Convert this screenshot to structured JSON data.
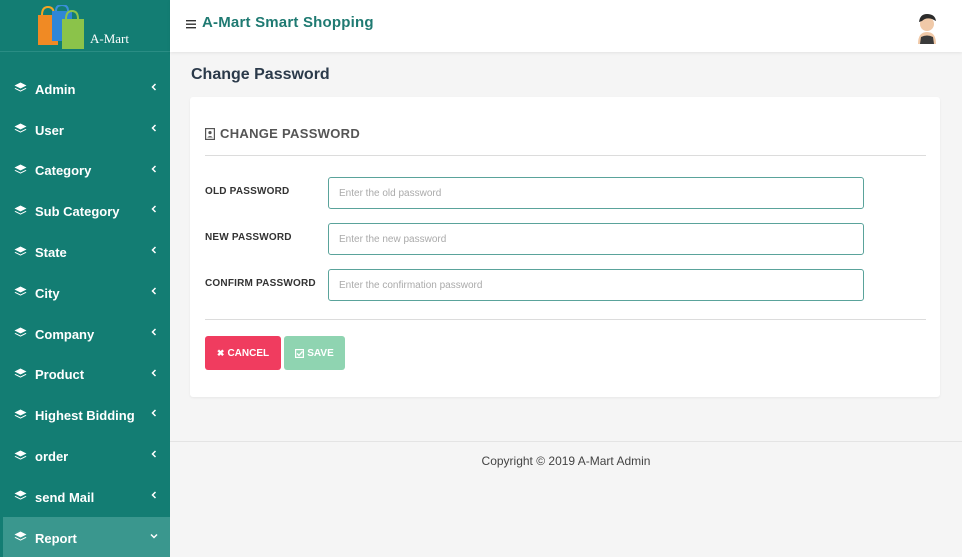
{
  "brand": {
    "name": "A-Mart"
  },
  "topbar": {
    "title": "A-Mart Smart Shopping"
  },
  "sidebar": {
    "items": [
      {
        "label": "Admin"
      },
      {
        "label": "User"
      },
      {
        "label": "Category"
      },
      {
        "label": "Sub Category"
      },
      {
        "label": "State"
      },
      {
        "label": "City"
      },
      {
        "label": "Company"
      },
      {
        "label": "Product"
      },
      {
        "label": "Highest Bidding"
      },
      {
        "label": "order"
      },
      {
        "label": "send Mail"
      },
      {
        "label": "Report",
        "active": true
      }
    ]
  },
  "page": {
    "title": "Change Password"
  },
  "form": {
    "header": "CHANGE PASSWORD",
    "old_password": {
      "label": "OLD PASSWORD",
      "placeholder": "Enter the old password",
      "value": ""
    },
    "new_password": {
      "label": "NEW PASSWORD",
      "placeholder": "Enter the new password",
      "value": ""
    },
    "confirm_password": {
      "label": "CONFIRM PASSWORD",
      "placeholder": "Enter the confirmation password",
      "value": ""
    },
    "cancel_label": "CANCEL",
    "save_label": "SAVE"
  },
  "footer": {
    "text": "Copyright © 2019 A-Mart Admin"
  },
  "colors": {
    "sidebar_bg": "#137d73",
    "sidebar_active": "#3a978e",
    "title_teal": "#1f7a72",
    "cancel": "#f03c5f",
    "save": "#8fd4b1"
  },
  "icons": {
    "menu_item": "layers-icon",
    "collapsed": "chevron-left-icon",
    "expanded": "chevron-down-icon",
    "header": "contact-card-icon",
    "cancel": "close-icon",
    "save": "check-square-icon"
  }
}
